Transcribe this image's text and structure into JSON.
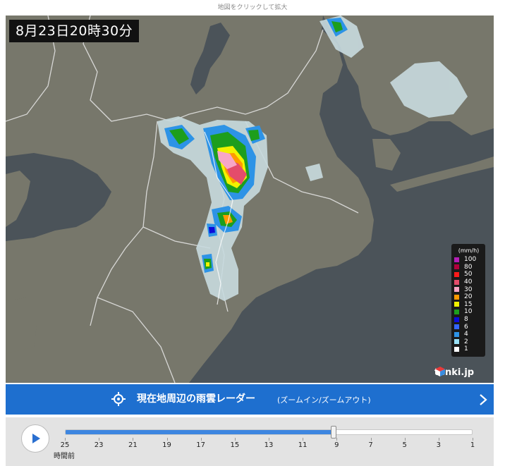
{
  "hint": "地図をクリックして拡大",
  "map": {
    "timestamp": "8月23日20時30分"
  },
  "legend": {
    "unit": "(mm/h)",
    "levels": [
      {
        "label": "100",
        "color": "#b41fb6"
      },
      {
        "label": "80",
        "color": "#b3003c"
      },
      {
        "label": "50",
        "color": "#ff1a1a"
      },
      {
        "label": "40",
        "color": "#e44c6b"
      },
      {
        "label": "30",
        "color": "#f7a6c6"
      },
      {
        "label": "20",
        "color": "#ff9900"
      },
      {
        "label": "15",
        "color": "#f2f200"
      },
      {
        "label": "10",
        "color": "#1d9e1d"
      },
      {
        "label": "8",
        "color": "#0b0bd9"
      },
      {
        "label": "6",
        "color": "#3366ff"
      },
      {
        "label": "4",
        "color": "#2d93e6"
      },
      {
        "label": "2",
        "color": "#99e0f5"
      },
      {
        "label": "1",
        "color": "#ffffff"
      }
    ]
  },
  "brand": {
    "name": "tenki.jp"
  },
  "banner": {
    "title": "現在地周辺の雨雲レーダー",
    "subtitle": "(ズームイン/ズームアウト)"
  },
  "timeline": {
    "labels": [
      "25",
      "23",
      "21",
      "19",
      "17",
      "15",
      "13",
      "11",
      "9",
      "7",
      "5",
      "3",
      "1"
    ],
    "axis_label": "時間前",
    "progress": 0.66
  },
  "colors": {
    "banner": "#1e6fcf",
    "track_fill": "#3d86e0",
    "sea": "#4a5258",
    "land": "#7a7a6e"
  }
}
